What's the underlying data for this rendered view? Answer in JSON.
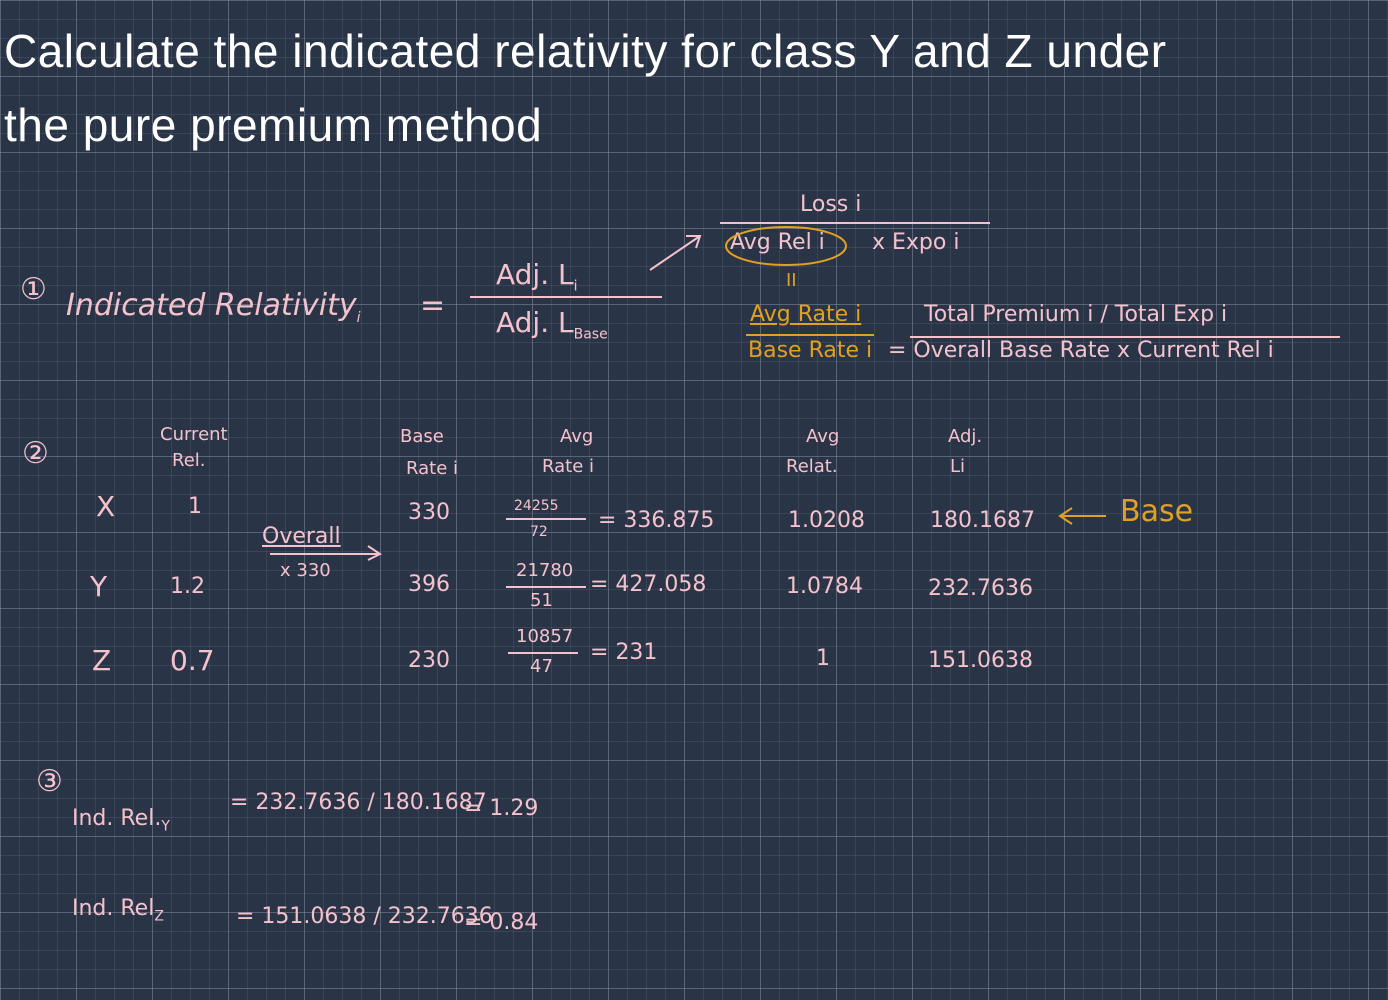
{
  "title": {
    "line1": "Calculate the indicated relativity for class Y and Z under",
    "line2": "the pure premium method"
  },
  "step1": {
    "marker": "①",
    "lhs": "Indicated Relativity",
    "lhs_sub": "i",
    "equals": "=",
    "num": "Adj. L",
    "num_sub": "i",
    "den": "Adj. L",
    "den_sub": "Base",
    "loss_num": "Loss i",
    "loss_den_circled": "Avg Rel i",
    "loss_den_rest": "x Expo i",
    "eq_mark": "II",
    "avg_rate": "Avg Rate i",
    "base_rate": "Base Rate i",
    "avg_rate_formula": "Total Premium i / Total Exp i",
    "base_rate_formula": "= Overall Base Rate x Current Rel i"
  },
  "step2": {
    "marker": "②",
    "headers": {
      "current_rel_1": "Current",
      "current_rel_2": "Rel.",
      "base_rate_1": "Base",
      "base_rate_2": "Rate i",
      "avg_rate_1": "Avg",
      "avg_rate_2": "Rate i",
      "avg_relat_1": "Avg",
      "avg_relat_2": "Relat.",
      "adj_li_1": "Adj.",
      "adj_li_2": "Li"
    },
    "overall_note_1": "Overall",
    "overall_note_2": "x 330",
    "base_label": "Base",
    "rows": [
      {
        "cls": "X",
        "cur": "1",
        "base": "330",
        "num": "24255",
        "den": "72",
        "avg": "= 336.875",
        "relat": "1.0208",
        "adj": "180.1687"
      },
      {
        "cls": "Y",
        "cur": "1.2",
        "base": "396",
        "num": "21780",
        "den": "51",
        "avg": "= 427.058",
        "relat": "1.0784",
        "adj": "232.7636"
      },
      {
        "cls": "Z",
        "cur": "0.7",
        "base": "230",
        "num": "10857",
        "den": "47",
        "avg": "= 231",
        "relat": "1",
        "adj": "151.0638"
      }
    ]
  },
  "step3": {
    "marker": "③",
    "line_y": {
      "label": "Ind. Rel.",
      "sub": "Y",
      "expr": "= 232.7636 / 180.1687",
      "result": "= 1.29"
    },
    "line_z": {
      "label": "Ind. Rel",
      "sub": "Z",
      "expr": "= 151.0638 / 232.7636",
      "result": "= 0.84"
    }
  },
  "colors": {
    "background": "#2a3447",
    "title": "#ffffff",
    "ink_pink": "#f4c2cc",
    "ink_gold": "#e0a020"
  }
}
